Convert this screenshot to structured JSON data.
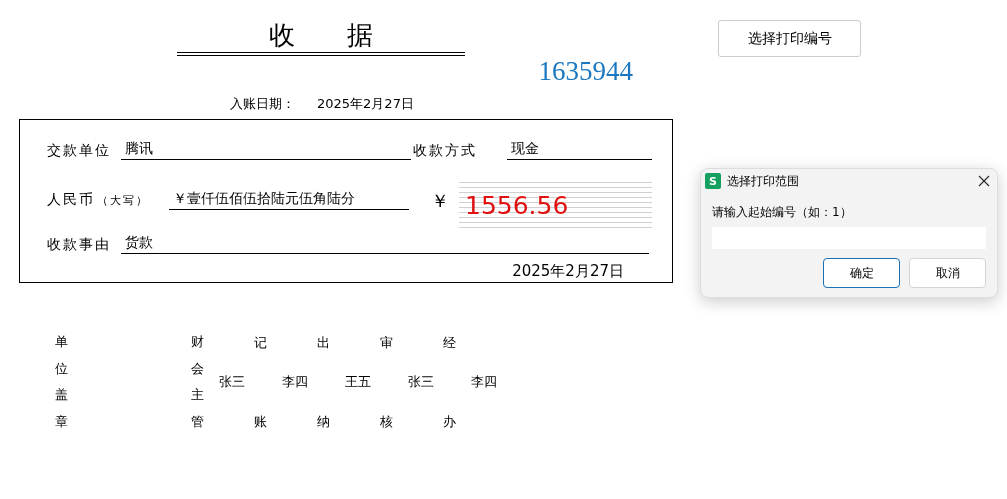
{
  "print_button": "选择打印编号",
  "receipt": {
    "title": "收　　据",
    "number": "1635944",
    "entry_date": {
      "label": "入账日期：",
      "value": "2025年2月27日"
    },
    "payer": {
      "label": "交款单位",
      "value": "腾讯"
    },
    "method": {
      "label": "收款方式",
      "value": "现金"
    },
    "amount_words": {
      "label": "人民币",
      "hint": "（大写）",
      "value": "￥壹仟伍佰伍拾陆元伍角陆分"
    },
    "amount": {
      "symbol": "￥",
      "value": "1556.56"
    },
    "reason": {
      "label": "收款事由",
      "value": "货款"
    },
    "date": "2025年2月27日"
  },
  "signatures": [
    {
      "label": "单位盖章"
    },
    {
      "label": "财会主管",
      "name": "张三"
    },
    {
      "label": "记账",
      "name": "李四"
    },
    {
      "label": "出纳",
      "name": "王五"
    },
    {
      "label": "审核",
      "name": "张三"
    },
    {
      "label": "经办",
      "name": "李四"
    }
  ],
  "dialog": {
    "app_icon": "S",
    "title": "选择打印范围",
    "prompt": "请输入起始编号（如：1）",
    "buttons": [
      {
        "label": "确定",
        "selected": true
      },
      {
        "label": "取消",
        "selected": false
      }
    ]
  }
}
